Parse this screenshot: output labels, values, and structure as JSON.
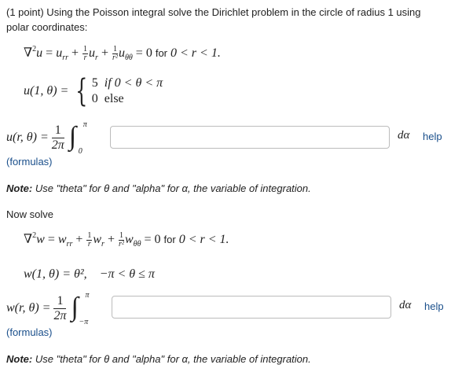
{
  "problem": {
    "intro_line1": "(1 point) Using the Poisson integral solve the Dirichlet problem in the circle of radius 1 using",
    "intro_line2": "polar coordinates:",
    "pde_for_text": "for",
    "part1": {
      "pde_range": "0 < r < 1.",
      "boundary_lhs": "u(1, θ) =",
      "case1_value": "5",
      "case1_condition": "if 0 < θ < π",
      "case2_value": "0",
      "case2_condition": "else",
      "solution_lhs": "u(r, θ) =",
      "integral_lower": "0",
      "integral_upper": "π",
      "answer_value": "",
      "differential": "dα",
      "help_label": "help",
      "formulas_label": "(formulas)",
      "note_bold": "Note:",
      "note_text": "Use \"theta\" for θ and \"alpha\" for α, the variable of integration."
    },
    "now_solve": "Now solve",
    "part2": {
      "pde_range": "0 < r < 1.",
      "boundary": "w(1, θ) = θ²,",
      "boundary_condition": "−π < θ ≤ π",
      "solution_lhs": "w(r, θ) =",
      "integral_lower": "−π",
      "integral_upper": "π",
      "answer_value": "",
      "differential": "dα",
      "help_label": "help",
      "formulas_label": "(formulas)",
      "note_bold": "Note:",
      "note_text": "Use \"theta\" for θ and \"alpha\" for α, the variable of integration."
    },
    "fraction_numerator": "1",
    "fraction_denominator": "2π"
  }
}
